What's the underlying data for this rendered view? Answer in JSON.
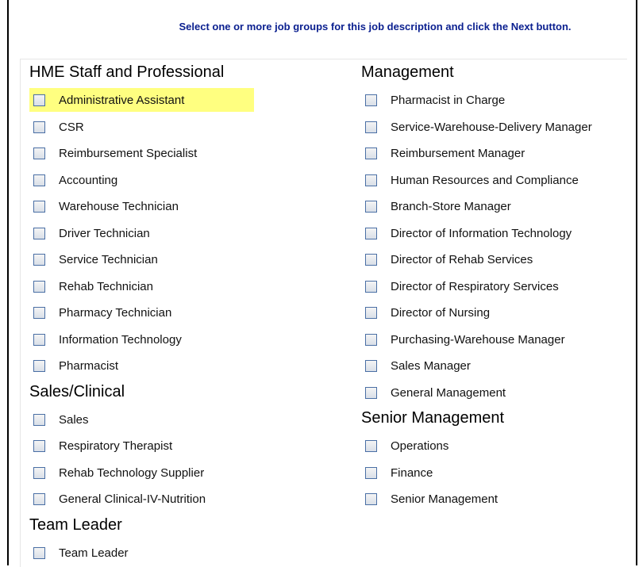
{
  "instruction": "Select one or more job groups for this job description and click the Next button.",
  "colors": {
    "instruction": "#0a1f8f",
    "highlight": "#ffff80",
    "checkbox_border": "#4a6fa5"
  },
  "left_column": [
    {
      "title": "HME Staff and Professional",
      "items": [
        {
          "label": "Administrative Assistant",
          "checked": false,
          "highlighted": true
        },
        {
          "label": "CSR",
          "checked": false
        },
        {
          "label": "Reimbursement Specialist",
          "checked": false
        },
        {
          "label": "Accounting",
          "checked": false
        },
        {
          "label": "Warehouse Technician",
          "checked": false
        },
        {
          "label": "Driver Technician",
          "checked": false
        },
        {
          "label": "Service Technician",
          "checked": false
        },
        {
          "label": "Rehab Technician",
          "checked": false
        },
        {
          "label": "Pharmacy Technician",
          "checked": false
        },
        {
          "label": "Information Technology",
          "checked": false
        },
        {
          "label": "Pharmacist",
          "checked": false
        }
      ]
    },
    {
      "title": "Sales/Clinical",
      "items": [
        {
          "label": "Sales",
          "checked": false
        },
        {
          "label": "Respiratory Therapist",
          "checked": false
        },
        {
          "label": "Rehab Technology Supplier",
          "checked": false
        },
        {
          "label": "General Clinical-IV-Nutrition",
          "checked": false
        }
      ]
    },
    {
      "title": "Team Leader",
      "items": [
        {
          "label": "Team Leader",
          "checked": false
        }
      ]
    }
  ],
  "right_column": [
    {
      "title": "Management",
      "items": [
        {
          "label": "Pharmacist in Charge",
          "checked": false
        },
        {
          "label": "Service-Warehouse-Delivery Manager",
          "checked": false
        },
        {
          "label": "Reimbursement Manager",
          "checked": false
        },
        {
          "label": "Human Resources and Compliance",
          "checked": false
        },
        {
          "label": "Branch-Store Manager",
          "checked": false
        },
        {
          "label": "Director of Information Technology",
          "checked": false
        },
        {
          "label": "Director of Rehab Services",
          "checked": false
        },
        {
          "label": "Director of Respiratory Services",
          "checked": false
        },
        {
          "label": "Director of Nursing",
          "checked": false
        },
        {
          "label": "Purchasing-Warehouse Manager",
          "checked": false
        },
        {
          "label": "Sales Manager",
          "checked": false
        },
        {
          "label": "General Management",
          "checked": false
        }
      ]
    },
    {
      "title": "Senior Management",
      "items": [
        {
          "label": "Operations",
          "checked": false
        },
        {
          "label": "Finance",
          "checked": false
        },
        {
          "label": "Senior Management",
          "checked": false
        }
      ]
    }
  ]
}
